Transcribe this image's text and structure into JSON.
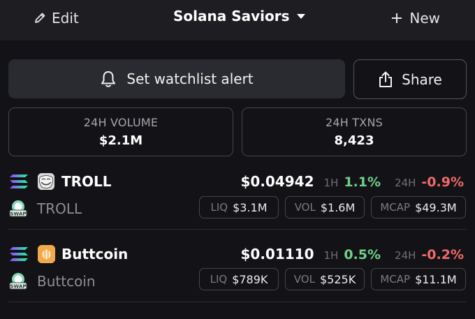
{
  "header": {
    "edit_label": "Edit",
    "title": "Solana Saviors",
    "new_label": "New"
  },
  "actions": {
    "alert_label": "Set watchlist alert",
    "share_label": "Share"
  },
  "stats": [
    {
      "label": "24H VOLUME",
      "value": "$2.1M"
    },
    {
      "label": "24H TXNS",
      "value": "8,423"
    }
  ],
  "tokens": [
    {
      "symbol": "TROLL",
      "name": "TROLL",
      "price": "$0.04942",
      "h1_label": "1H",
      "h1": "1.1%",
      "h24_label": "24H",
      "h24": "-0.9%",
      "liq_label": "LIQ",
      "liq": "$3.1M",
      "vol_label": "VOL",
      "vol": "$1.6M",
      "mcap_label": "MCAP",
      "mcap": "$49.3M"
    },
    {
      "symbol": "Buttcoin",
      "name": "Buttcoin",
      "price": "$0.01110",
      "h1_label": "1H",
      "h1": "0.5%",
      "h24_label": "24H",
      "h24": "-0.2%",
      "liq_label": "LIQ",
      "liq": "$789K",
      "vol_label": "VOL",
      "vol": "$525K",
      "mcap_label": "MCAP",
      "mcap": "$11.1M"
    }
  ],
  "icons": {
    "edit": "pencil-icon",
    "dropdown": "caret-down-icon",
    "new": "plus-icon",
    "alert": "bell-icon",
    "share": "share-icon",
    "chain": "solana-icon",
    "dex": "swap-icon"
  },
  "colors": {
    "background": "#131317",
    "header": "#1e1e22",
    "positive": "#6fd08a",
    "negative": "#ef6a6a"
  }
}
